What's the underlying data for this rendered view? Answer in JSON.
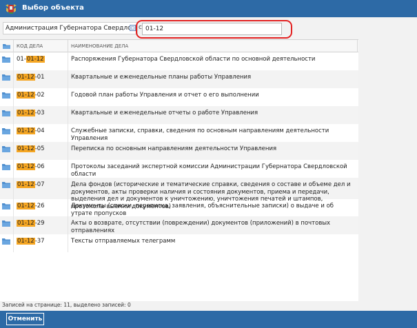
{
  "window": {
    "title": "Выбор объекта"
  },
  "toolbar": {
    "organization": "Администрация Губернатора Свердловской",
    "organization_picker_glyph": "☐",
    "separator_text": "с",
    "search_value": "01-12",
    "search_highlight_color": "#e32121"
  },
  "table": {
    "columns": [
      "КОД ДЕЛА",
      "НАИМЕНОВАНИЕ ДЕЛА"
    ],
    "highlight_color": "#f5a623",
    "rows": [
      {
        "code_prefix": "01-",
        "code_match": "01-12",
        "code_suffix": "",
        "name": "Распоряжения Губернатора Свердловской области по основной деятельности"
      },
      {
        "code_prefix": "",
        "code_match": "01-12",
        "code_suffix": "-01",
        "name": "Квартальные и еженедельные планы работы Управления"
      },
      {
        "code_prefix": "",
        "code_match": "01-12",
        "code_suffix": "-02",
        "name": "Годовой план работы Управления и отчет о его выполнении"
      },
      {
        "code_prefix": "",
        "code_match": "01-12",
        "code_suffix": "-03",
        "name": "Квартальные и еженедельные отчеты о работе Управления"
      },
      {
        "code_prefix": "",
        "code_match": "01-12",
        "code_suffix": "-04",
        "name": "Служебные записки, справки, сведения по основным направлениям деятельности Управления"
      },
      {
        "code_prefix": "",
        "code_match": "01-12",
        "code_suffix": "-05",
        "name": "Переписка по основным направлениям деятельности Управления"
      },
      {
        "code_prefix": "",
        "code_match": "01-12",
        "code_suffix": "-06",
        "name": "Протоколы заседаний экспертной комиссии Администрации Губернатора Свердловской области"
      },
      {
        "code_prefix": "",
        "code_match": "01-12",
        "code_suffix": "-07",
        "name": "Дела фондов (исторические и тематические справки, сведения о составе и объеме дел и документов, акты проверки наличия и состояния документов, приема и передачи, выделения дел и документов к уничтожению, уничтожения печатей и штампов, протоколы выемки документов)"
      },
      {
        "code_prefix": "",
        "code_match": "01-12",
        "code_suffix": "-26",
        "name": "Документы (списки, переписка, заявления, объяснительные записки) о выдаче и об утрате пропусков"
      },
      {
        "code_prefix": "",
        "code_match": "01-12",
        "code_suffix": "-29",
        "name": "Акты о возврате, отсутствии (повреждении) документов (приложений) в почтовых отправлениях"
      },
      {
        "code_prefix": "",
        "code_match": "01-12",
        "code_suffix": "-37",
        "name": "Тексты отправляемых телеграмм"
      }
    ]
  },
  "status": {
    "text": "Записей на странице: 11, выделено записей: 0"
  },
  "footer": {
    "cancel_label": "Отменить"
  },
  "theme": {
    "titlebar_color": "#2d6aa6",
    "folder_icon_color": "#4f8fcf"
  },
  "icons": {
    "app": "coat-of-arms-icon",
    "row": "folder-icon"
  }
}
